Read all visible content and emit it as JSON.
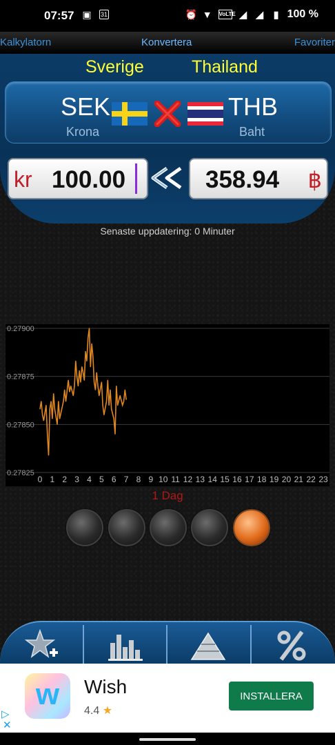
{
  "status_bar": {
    "time": "07:57",
    "calendar_day": "31",
    "battery": "100 %"
  },
  "tabs": [
    {
      "label": "Kalkylatorn"
    },
    {
      "label": "Konvertera"
    },
    {
      "label": "Favoriter"
    }
  ],
  "converter": {
    "from": {
      "country": "Sverige",
      "code": "SEK",
      "name": "Krona",
      "symbol": "kr",
      "amount": "100.00",
      "flag": "sweden-flag"
    },
    "to": {
      "country": "Thailand",
      "code": "THB",
      "name": "Baht",
      "symbol": "฿",
      "amount": "358.94",
      "flag": "thailand-flag"
    },
    "last_update": "Senaste uppdatering: 0 Minuter"
  },
  "chart_data": {
    "type": "line",
    "title": "",
    "xlabel": "",
    "ylabel": "",
    "x_ticks": [
      0,
      1,
      2,
      3,
      4,
      5,
      6,
      7,
      8,
      9,
      10,
      11,
      12,
      13,
      14,
      15,
      16,
      17,
      18,
      19,
      20,
      21,
      22,
      23
    ],
    "y_ticks": [
      "0.27825",
      "0.27850",
      "0.27875",
      "0.27900"
    ],
    "ylim": [
      0.27825,
      0.279
    ],
    "xlim": [
      0,
      23.5
    ],
    "grid": true,
    "line_color": "#e0871e",
    "series": [
      {
        "values": [
          [
            0.0,
            0.27858
          ],
          [
            0.1,
            0.27862
          ],
          [
            0.2,
            0.27855
          ],
          [
            0.3,
            0.27852
          ],
          [
            0.5,
            0.2786
          ],
          [
            0.6,
            0.27845
          ],
          [
            0.7,
            0.27834
          ],
          [
            0.8,
            0.27858
          ],
          [
            0.9,
            0.27862
          ],
          [
            1.0,
            0.27853
          ],
          [
            1.1,
            0.27866
          ],
          [
            1.2,
            0.27858
          ],
          [
            1.4,
            0.2785
          ],
          [
            1.5,
            0.27862
          ],
          [
            1.6,
            0.27853
          ],
          [
            1.7,
            0.27856
          ],
          [
            1.9,
            0.27862
          ],
          [
            2.0,
            0.27868
          ],
          [
            2.1,
            0.27862
          ],
          [
            2.3,
            0.27873
          ],
          [
            2.4,
            0.27867
          ],
          [
            2.5,
            0.2787
          ],
          [
            2.7,
            0.27865
          ],
          [
            2.8,
            0.2787
          ],
          [
            2.9,
            0.27883
          ],
          [
            3.0,
            0.27875
          ],
          [
            3.1,
            0.2787
          ],
          [
            3.2,
            0.27878
          ],
          [
            3.3,
            0.27872
          ],
          [
            3.4,
            0.2788
          ],
          [
            3.5,
            0.27877
          ],
          [
            3.6,
            0.27873
          ],
          [
            3.7,
            0.27888
          ],
          [
            3.8,
            0.27883
          ],
          [
            3.9,
            0.27895
          ],
          [
            4.0,
            0.279
          ],
          [
            4.1,
            0.2788
          ],
          [
            4.2,
            0.27892
          ],
          [
            4.3,
            0.27885
          ],
          [
            4.4,
            0.27872
          ],
          [
            4.5,
            0.27868
          ],
          [
            4.6,
            0.27877
          ],
          [
            4.7,
            0.2787
          ],
          [
            4.8,
            0.27865
          ],
          [
            5.0,
            0.27872
          ],
          [
            5.1,
            0.2786
          ],
          [
            5.2,
            0.27855
          ],
          [
            5.4,
            0.27862
          ],
          [
            5.5,
            0.27873
          ],
          [
            5.6,
            0.2786
          ],
          [
            5.7,
            0.27868
          ],
          [
            5.8,
            0.27858
          ],
          [
            6.0,
            0.27853
          ],
          [
            6.1,
            0.27845
          ],
          [
            6.2,
            0.2787
          ],
          [
            6.3,
            0.2786
          ],
          [
            6.5,
            0.27865
          ],
          [
            6.7,
            0.2786
          ],
          [
            6.8,
            0.27862
          ],
          [
            6.9,
            0.27868
          ],
          [
            7.0,
            0.27863
          ]
        ]
      }
    ]
  },
  "chart_period_label": "1 Dag",
  "period_buttons": [
    {
      "active": false
    },
    {
      "active": false
    },
    {
      "active": false
    },
    {
      "active": false
    },
    {
      "active": true
    }
  ],
  "toolbar": [
    {
      "icon": "favorite-add-icon"
    },
    {
      "icon": "bar-chart-icon"
    },
    {
      "icon": "pyramid-icon"
    },
    {
      "icon": "percent-icon"
    }
  ],
  "ad": {
    "title": "Wish",
    "rating": "4.4",
    "button_label": "INSTALLERA",
    "logo_letter": "w"
  }
}
